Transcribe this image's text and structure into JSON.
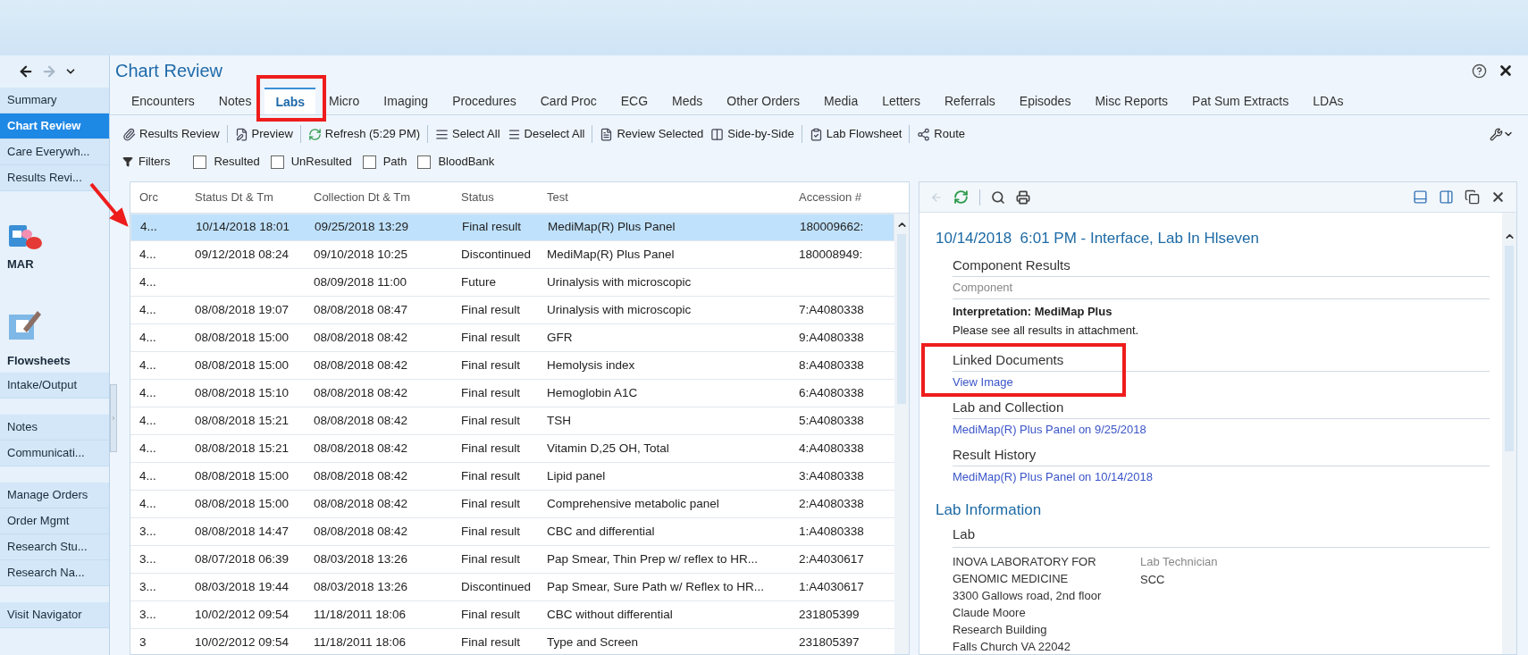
{
  "sidebar": {
    "groups": [
      [
        {
          "label": "Summary",
          "selected": false,
          "kind": "link"
        },
        {
          "label": "Chart Review",
          "selected": true,
          "kind": "link"
        },
        {
          "label": "Care Everywh...",
          "selected": false,
          "kind": "link"
        },
        {
          "label": "Results Revi...",
          "selected": false,
          "kind": "link"
        }
      ],
      [
        {
          "label": "MAR",
          "selected": false,
          "kind": "tile"
        }
      ],
      [
        {
          "label": "Flowsheets",
          "selected": false,
          "kind": "tile"
        },
        {
          "label": "Intake/Output",
          "selected": false,
          "kind": "link"
        }
      ],
      [
        {
          "label": "Notes",
          "selected": false,
          "kind": "link"
        },
        {
          "label": "Communicati...",
          "selected": false,
          "kind": "link"
        }
      ],
      [
        {
          "label": "Manage Orders",
          "selected": false,
          "kind": "link"
        },
        {
          "label": "Order Mgmt",
          "selected": false,
          "kind": "link"
        },
        {
          "label": "Research Stu...",
          "selected": false,
          "kind": "link"
        },
        {
          "label": "Research Na...",
          "selected": false,
          "kind": "link"
        }
      ],
      [
        {
          "label": "Visit Navigator",
          "selected": false,
          "kind": "link"
        }
      ]
    ]
  },
  "window": {
    "title": "Chart Review"
  },
  "tabs": [
    {
      "label": "Encounters",
      "selected": false
    },
    {
      "label": "Notes",
      "selected": false
    },
    {
      "label": "Labs",
      "selected": true
    },
    {
      "label": "Micro",
      "selected": false
    },
    {
      "label": "Imaging",
      "selected": false
    },
    {
      "label": "Procedures",
      "selected": false
    },
    {
      "label": "Card Proc",
      "selected": false
    },
    {
      "label": "ECG",
      "selected": false
    },
    {
      "label": "Meds",
      "selected": false
    },
    {
      "label": "Other Orders",
      "selected": false
    },
    {
      "label": "Media",
      "selected": false
    },
    {
      "label": "Letters",
      "selected": false
    },
    {
      "label": "Referrals",
      "selected": false
    },
    {
      "label": "Episodes",
      "selected": false
    },
    {
      "label": "Misc Reports",
      "selected": false
    },
    {
      "label": "Pat Sum Extracts",
      "selected": false
    },
    {
      "label": "LDAs",
      "selected": false
    }
  ],
  "toolbar": [
    "Results Review",
    "Preview",
    "Refresh (5:29 PM)",
    "Select All",
    "Deselect All",
    "Review Selected",
    "Side-by-Side",
    "Lab Flowsheet",
    "Route"
  ],
  "filters": {
    "label": "Filters",
    "options": [
      {
        "label": "Resulted",
        "checked": false
      },
      {
        "label": "UnResulted",
        "checked": false
      },
      {
        "label": "Path",
        "checked": false
      },
      {
        "label": "BloodBank",
        "checked": false
      }
    ]
  },
  "table": {
    "columns": [
      "Orc",
      "Status Dt & Tm",
      "Collection Dt & Tm",
      "Status",
      "Test",
      "Accession #"
    ],
    "rows": [
      {
        "cells": [
          "4...",
          "10/14/2018 18:01",
          "09/25/2018 13:29",
          "Final result",
          "MediMap(R) Plus Panel",
          "180009662:"
        ],
        "selected": true
      },
      {
        "cells": [
          "4...",
          "09/12/2018 08:24",
          "09/10/2018 10:25",
          "Discontinued",
          "MediMap(R) Plus Panel",
          "180008949:"
        ],
        "selected": false
      },
      {
        "cells": [
          "4...",
          "",
          "08/09/2018 11:00",
          "Future",
          "Urinalysis with microscopic",
          ""
        ],
        "selected": false
      },
      {
        "cells": [
          "4...",
          "08/08/2018 19:07",
          "08/08/2018 08:47",
          "Final result",
          "Urinalysis with microscopic",
          "7:A4080338"
        ],
        "selected": false
      },
      {
        "cells": [
          "4...",
          "08/08/2018 15:00",
          "08/08/2018 08:42",
          "Final result",
          "GFR",
          "9:A4080338"
        ],
        "selected": false
      },
      {
        "cells": [
          "4...",
          "08/08/2018 15:00",
          "08/08/2018 08:42",
          "Final result",
          "Hemolysis index",
          "8:A4080338"
        ],
        "selected": false
      },
      {
        "cells": [
          "4...",
          "08/08/2018 15:10",
          "08/08/2018 08:42",
          "Final result",
          "Hemoglobin A1C",
          "6:A4080338"
        ],
        "selected": false
      },
      {
        "cells": [
          "4...",
          "08/08/2018 15:21",
          "08/08/2018 08:42",
          "Final result",
          "TSH",
          "5:A4080338"
        ],
        "selected": false
      },
      {
        "cells": [
          "4...",
          "08/08/2018 15:21",
          "08/08/2018 08:42",
          "Final result",
          "Vitamin D,25 OH, Total",
          "4:A4080338"
        ],
        "selected": false
      },
      {
        "cells": [
          "4...",
          "08/08/2018 15:00",
          "08/08/2018 08:42",
          "Final result",
          "Lipid panel",
          "3:A4080338"
        ],
        "selected": false
      },
      {
        "cells": [
          "4...",
          "08/08/2018 15:00",
          "08/08/2018 08:42",
          "Final result",
          "Comprehensive metabolic panel",
          "2:A4080338"
        ],
        "selected": false
      },
      {
        "cells": [
          "3...",
          "08/08/2018 14:47",
          "08/08/2018 08:42",
          "Final result",
          "CBC and differential",
          "1:A4080338"
        ],
        "selected": false
      },
      {
        "cells": [
          "3...",
          "08/07/2018 06:39",
          "08/03/2018 13:26",
          "Final result",
          "Pap Smear, Thin Prep w/ reflex to HR...",
          "2:A4030617"
        ],
        "selected": false
      },
      {
        "cells": [
          "3...",
          "08/03/2018 19:44",
          "08/03/2018 13:26",
          "Discontinued",
          "Pap Smear, Sure Path w/ Reflex to HR...",
          "1:A4030617"
        ],
        "selected": false
      },
      {
        "cells": [
          "3...",
          "10/02/2012 09:54",
          "11/18/2011 18:06",
          "Final result",
          "CBC without differential",
          "231805399"
        ],
        "selected": false
      },
      {
        "cells": [
          "3",
          "10/02/2012 09:54",
          "11/18/2011 18:06",
          "Final result",
          "Type and Screen",
          "231805397"
        ],
        "selected": false
      }
    ]
  },
  "detail": {
    "heading": "10/14/2018  6:01 PM - Interface, Lab In Hlseven",
    "component_results": {
      "title": "Component Results",
      "column": "Component",
      "interpretation": "Interpretation: MediMap Plus",
      "note": "Please see all results in attachment."
    },
    "linked_documents": {
      "title": "Linked Documents",
      "link": "View Image"
    },
    "lab_and_collection": {
      "title": "Lab and Collection",
      "link": "MediMap(R) Plus Panel on 9/25/2018"
    },
    "result_history": {
      "title": "Result History",
      "link": "MediMap(R) Plus Panel on 10/14/2018"
    },
    "lab_information": {
      "title": "Lab Information",
      "subtitle": "Lab",
      "address": [
        "INOVA LABORATORY FOR",
        "GENOMIC MEDICINE",
        "3300 Gallows road, 2nd floor",
        "Claude Moore",
        "Research Building",
        "Falls Church VA 22042"
      ],
      "role_label": "Lab Technician",
      "role_value": "SCC"
    }
  }
}
